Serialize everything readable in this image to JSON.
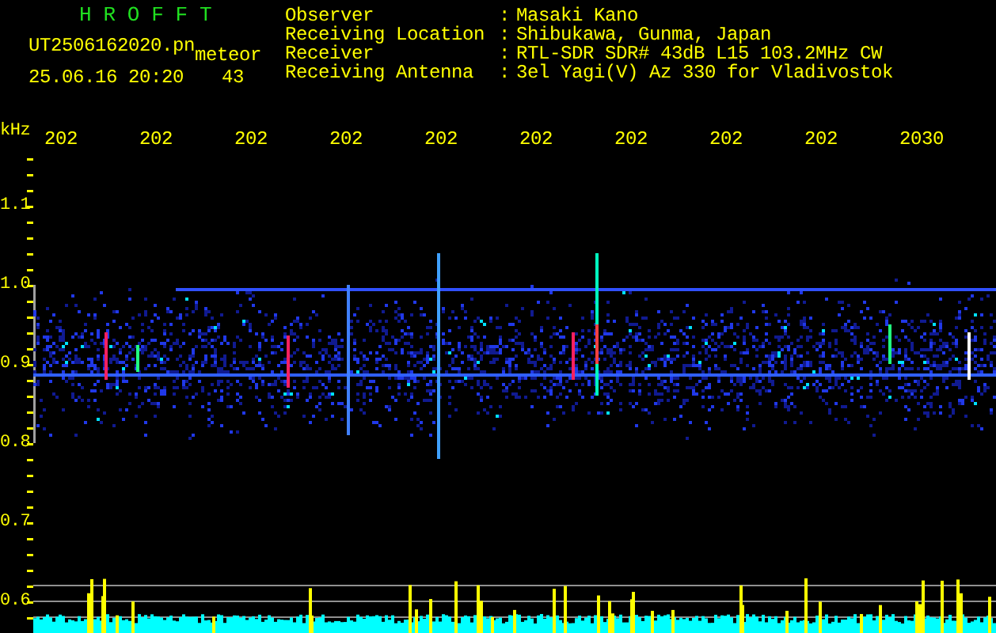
{
  "header": {
    "title": "H R O F F T",
    "file_name": "UT2506162020.pn",
    "event_type": "meteor",
    "timestamp": "25.06.16 20:20",
    "count": "43"
  },
  "info": [
    {
      "label": "Observer",
      "separator": ":",
      "value": "Masaki Kano"
    },
    {
      "label": "Receiving Location",
      "separator": ":",
      "value": "Shibukawa, Gunma, Japan"
    },
    {
      "label": "Receiver",
      "separator": ":",
      "value": "RTL-SDR SDR# 43dB L15 103.2MHz CW"
    },
    {
      "label": "Receiving Antenna",
      "separator": ":",
      "value": "3el Yagi(V) Az 330 for Vladivostok"
    }
  ],
  "axis": {
    "unit": "kHz",
    "time_labels": [
      "202",
      "202",
      "202",
      "202",
      "202",
      "202",
      "202",
      "202",
      "202",
      "2030"
    ],
    "freq_labels": [
      "1.1",
      "1.0",
      "0.9",
      "0.8",
      "0.7",
      "0.6"
    ]
  }
}
